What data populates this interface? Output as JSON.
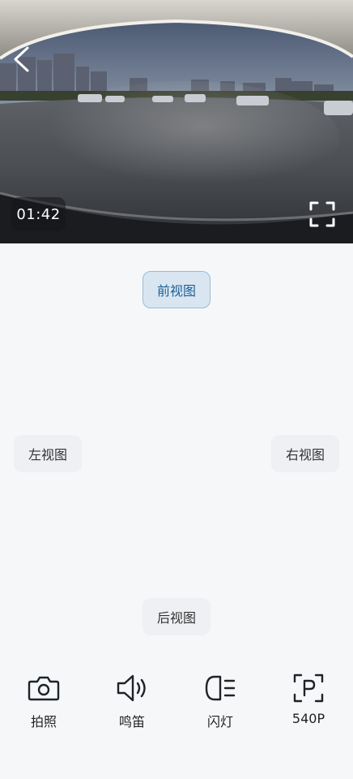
{
  "feed": {
    "timer": "01:42"
  },
  "views": {
    "front": "前视图",
    "left": "左视图",
    "right": "右视图",
    "rear": "后视图"
  },
  "toolbar": {
    "photo": "拍照",
    "horn": "鸣笛",
    "light": "闪灯",
    "resolution": "540P"
  },
  "icons": {
    "back": "chevron-left-icon",
    "fullscreen": "fullscreen-icon",
    "photo": "camera-icon",
    "horn": "speaker-icon",
    "light": "headlight-icon",
    "resolution": "parking-icon"
  }
}
